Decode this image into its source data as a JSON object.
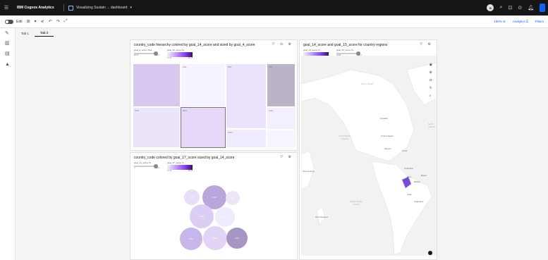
{
  "topbar": {
    "brand": "IBM Cognos Analytics",
    "doc_title": "Visualizing Sustain ... dashboard",
    "avatar_initial": "B"
  },
  "toolbar": {
    "edit_label": "Edit",
    "zoom": "100% ⊖",
    "analytics": "Analytics ⍈",
    "filters": "Filters"
  },
  "tabs": [
    "Tab 1",
    "Tab 2"
  ],
  "treemap_panel": {
    "title": "country_code hierarchy colored by goal_14_score and sized by goal_4_score",
    "legend_size": {
      "label": "goal_4_score (Sva...",
      "min": "96.00",
      "max": "99.0"
    },
    "legend_color": {
      "label": "goal_14_score (S...",
      "min": "37.40",
      "mid": "",
      "max": "69.13"
    },
    "tiles": [
      {
        "label": "",
        "color": "#d8c8ef"
      },
      {
        "label": "CHL",
        "color": "#f6f2ff"
      },
      {
        "label": "EST",
        "color": "#ebe2fb"
      },
      {
        "label": "FIN",
        "color": "#bcb3c9"
      },
      {
        "label": "DEU",
        "color": "#e5d8f8"
      },
      {
        "label": "GRC",
        "color": "#f0eafd"
      },
      {
        "label": "CAN",
        "color": "#f4efff"
      },
      {
        "label": "SVN",
        "color": "#ece4fb"
      },
      {
        "label": "",
        "color": "#f7f3ff"
      }
    ]
  },
  "map_panel": {
    "title": "goal_14_score and goal_15_score for country regions",
    "legend_a": {
      "label": "goal_14_score (S...",
      "min": "37.40",
      "max": "75.1"
    },
    "legend_b": {
      "label": "goal_15_score (S...",
      "min": "40.88",
      "max": "92.1"
    },
    "places": {
      "arctic": "Arctic Ocean",
      "canada": "Canada",
      "usa": "United States",
      "north_pacific": "North Pacific Ocean",
      "mexico": "Mexico",
      "cuba": "Cuba",
      "colombia": "Colombia",
      "brazil": "Brazil",
      "peru": "Peru",
      "bolivia": "Bolivia",
      "chile": "Chile",
      "argentina": "Argentina",
      "south_pacific": "South Pacific Ocean",
      "nz": "New Zealand",
      "north_atlantic": "North Atlantic",
      "new_guinea": "New Guinea"
    }
  },
  "bubble_panel": {
    "title": "country_code colored by goal_17_score sized by goal_14_score",
    "legend_size": {
      "label": "goal_14_score (S...",
      "min": "0",
      "max": "69.13"
    },
    "legend_color": {
      "label": "goal_17_score (S...",
      "min": "47.10",
      "max": "86.03"
    },
    "bubbles": [
      {
        "label": "SRB",
        "color": "#e7ddf8"
      },
      {
        "label": "USA",
        "color": "#b9a6d9"
      },
      {
        "label": "FIN",
        "color": "#ece6f6"
      },
      {
        "label": "CAN",
        "color": "#dccdf4"
      },
      {
        "label": "SVN",
        "color": "#f0eafd"
      },
      {
        "label": "CHL",
        "color": "#c8b6ea"
      },
      {
        "label": "DEU",
        "color": "#e2d4f7"
      },
      {
        "label": "AUS",
        "color": "#a796c3"
      },
      {
        "label": "EST",
        "color": "#c9b1ef"
      }
    ]
  }
}
